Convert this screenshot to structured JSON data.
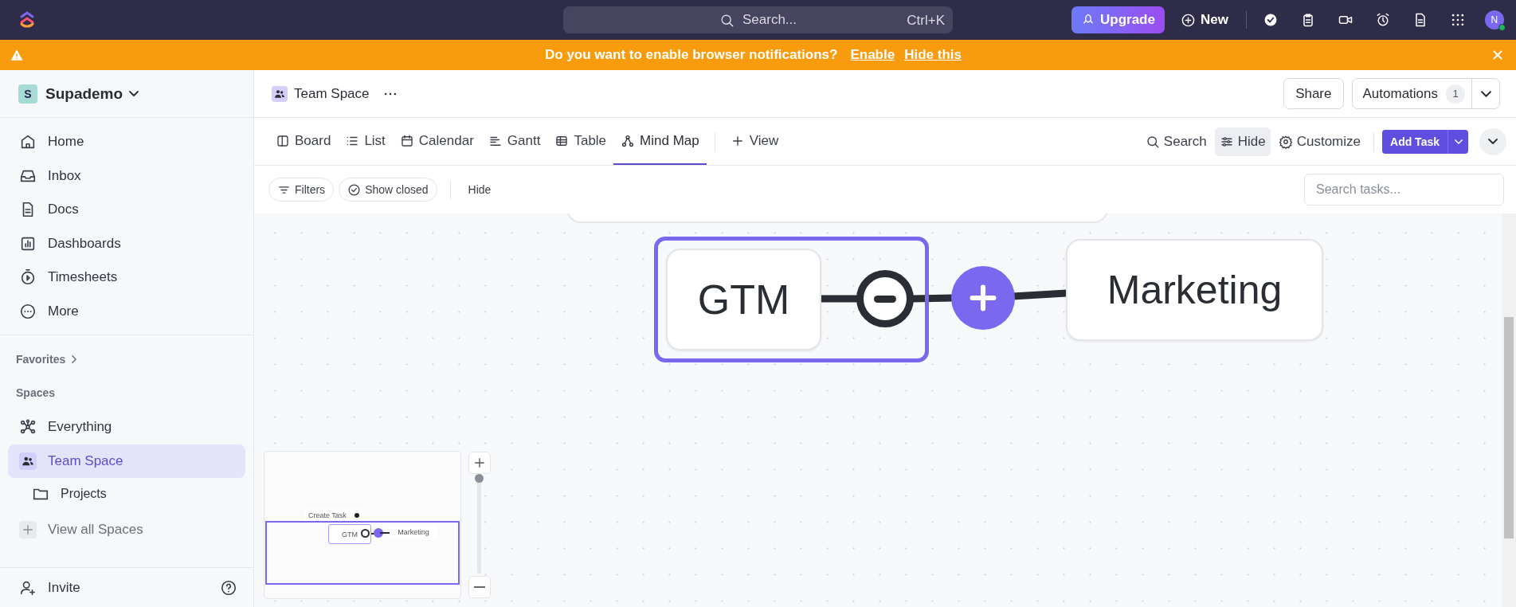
{
  "topbar": {
    "search_placeholder": "Search...",
    "shortcut": "Ctrl+K",
    "upgrade": "Upgrade",
    "new": "New",
    "avatar": "N"
  },
  "banner": {
    "message": "Do you want to enable browser notifications?",
    "links": [
      "Enable",
      "Hide this"
    ]
  },
  "sidebar": {
    "workspace": {
      "initial": "S",
      "name": "Supademo"
    },
    "nav": [
      {
        "label": "Home",
        "kind": "home"
      },
      {
        "label": "Inbox",
        "kind": "inbox"
      },
      {
        "label": "Docs",
        "kind": "doc"
      },
      {
        "label": "Dashboards",
        "kind": "chart"
      },
      {
        "label": "Timesheets",
        "kind": "timer"
      },
      {
        "label": "More",
        "kind": "more"
      }
    ],
    "favorites": "Favorites",
    "spaces_heading": "Spaces",
    "spaces": [
      {
        "label": "Everything",
        "kind": "everything",
        "selected": false
      },
      {
        "label": "Team Space",
        "kind": "team",
        "selected": true,
        "children": [
          {
            "label": "Projects",
            "kind": "folder",
            "selected": false
          }
        ]
      }
    ],
    "view_all": "View all Spaces",
    "invite": "Invite"
  },
  "header": {
    "title": "Team Space",
    "share": "Share",
    "automations": {
      "label": "Automations",
      "count": "1"
    }
  },
  "views": [
    {
      "label": "Board",
      "kind": "board",
      "selected": false
    },
    {
      "label": "List",
      "kind": "list",
      "selected": false
    },
    {
      "label": "Calendar",
      "kind": "calendar",
      "selected": false
    },
    {
      "label": "Gantt",
      "kind": "gantt",
      "selected": false
    },
    {
      "label": "Table",
      "kind": "table",
      "selected": false
    },
    {
      "label": "Mind Map",
      "kind": "mindmap",
      "selected": true
    }
  ],
  "add_view": "View",
  "view_actions": [
    {
      "label": "Search",
      "kind": "search",
      "selected": false
    },
    {
      "label": "Hide",
      "kind": "sliders",
      "selected": true
    },
    {
      "label": "Customize",
      "kind": "gear",
      "selected": false
    }
  ],
  "add_task": "Add Task",
  "filters": {
    "buttons": [
      {
        "label": "Filters",
        "kind": "filter"
      },
      {
        "label": "Show closed",
        "kind": "check"
      }
    ],
    "hide": "Hide",
    "search_placeholder": "Search tasks..."
  },
  "mindmap": {
    "nodes": [
      {
        "label": "GTM",
        "selected": true
      },
      {
        "label": "Marketing",
        "selected": false
      }
    ],
    "minimap": {
      "toolbar": "Create Task",
      "nodes": [
        "GTM",
        "Marketing"
      ]
    },
    "zoom": {
      "level": 1
    }
  }
}
